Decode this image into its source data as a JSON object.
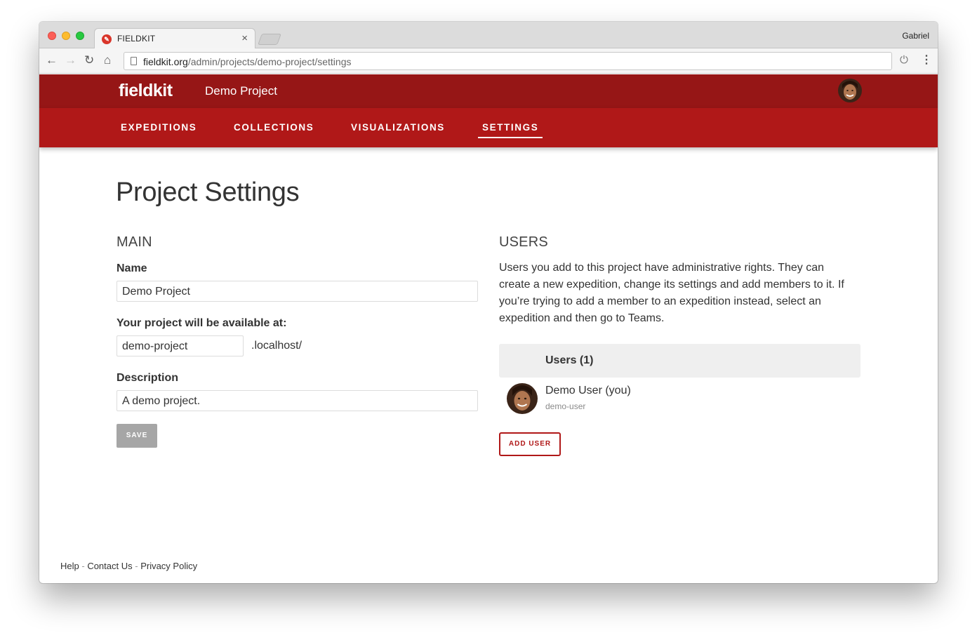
{
  "browser": {
    "tab_title": "FIELDKIT",
    "tab_close": "×",
    "profile_name": "Gabriel",
    "url_host": "fieldkit.org",
    "url_path": "/admin/projects/demo-project/settings"
  },
  "header": {
    "logo": "fieldkit",
    "project_name": "Demo Project"
  },
  "nav": {
    "items": [
      {
        "label": "EXPEDITIONS"
      },
      {
        "label": "COLLECTIONS"
      },
      {
        "label": "VISUALIZATIONS"
      },
      {
        "label": "SETTINGS"
      }
    ],
    "active": "SETTINGS"
  },
  "page": {
    "title": "Project Settings"
  },
  "main": {
    "section_title": "MAIN",
    "name_label": "Name",
    "name_value": "Demo Project",
    "url_label": "Your project will be available at:",
    "url_value": "demo-project",
    "url_suffix": ".localhost/",
    "description_label": "Description",
    "description_value": "A demo project.",
    "save_label": "SAVE"
  },
  "users": {
    "section_title": "USERS",
    "description": "Users you add to this project have administrative rights. They can create a new expedition, change its settings and add members to it. If you’re trying to add a member to an expedition instead, select an expedition and then go to Teams.",
    "table_header": "Users (1)",
    "list": [
      {
        "name": "Demo User (you)",
        "handle": "demo-user"
      }
    ],
    "add_label": "ADD USER"
  },
  "footer": {
    "help": "Help",
    "contact": "Contact Us",
    "privacy": "Privacy Policy",
    "separator": " - "
  },
  "colors": {
    "header_dark": "#961616",
    "header_nav": "#b01818",
    "save_disabled": "#a6a6a6"
  }
}
